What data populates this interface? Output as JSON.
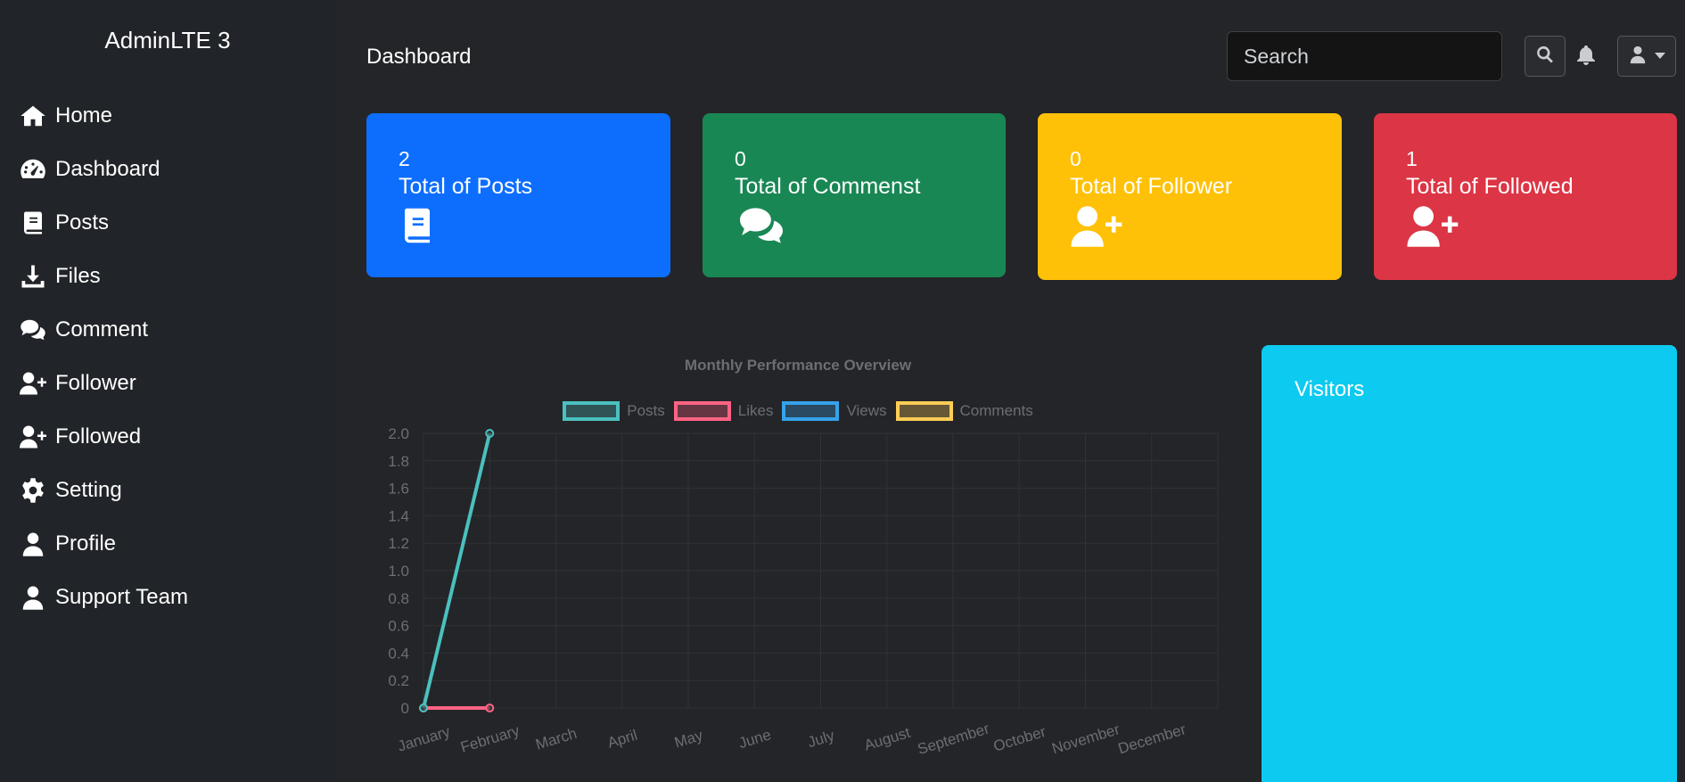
{
  "brand": "AdminLTE 3",
  "sidebar": {
    "items": [
      {
        "label": "Home",
        "icon": "home-icon"
      },
      {
        "label": "Dashboard",
        "icon": "gauge-icon"
      },
      {
        "label": "Posts",
        "icon": "book-icon"
      },
      {
        "label": "Files",
        "icon": "download-icon"
      },
      {
        "label": "Comment",
        "icon": "comments-icon"
      },
      {
        "label": "Follower",
        "icon": "user-plus-icon"
      },
      {
        "label": "Followed",
        "icon": "user-plus-icon"
      },
      {
        "label": "Setting",
        "icon": "gear-icon"
      },
      {
        "label": "Profile",
        "icon": "user-icon"
      },
      {
        "label": "Support Team",
        "icon": "user-icon"
      }
    ]
  },
  "header": {
    "title": "Dashboard",
    "search_placeholder": "Search"
  },
  "cards": [
    {
      "value": "2",
      "label": "Total of Posts",
      "icon": "book-icon",
      "color": "#0d6efd"
    },
    {
      "value": "0",
      "label": "Total of Commenst",
      "icon": "comments-icon",
      "color": "#198754"
    },
    {
      "value": "0",
      "label": "Total of Follower",
      "icon": "user-plus-icon",
      "color": "#ffc107"
    },
    {
      "value": "1",
      "label": "Total of Followed",
      "icon": "user-plus-icon",
      "color": "#dc3545"
    }
  ],
  "chart_data": {
    "type": "line",
    "title": "Monthly Performance Overview",
    "categories": [
      "January",
      "February",
      "March",
      "April",
      "May",
      "June",
      "July",
      "August",
      "September",
      "October",
      "November",
      "December"
    ],
    "series": [
      {
        "name": "Posts",
        "color": "#4bc0c0",
        "values": [
          0,
          2
        ]
      },
      {
        "name": "Likes",
        "color": "#ff6384",
        "values": [
          0,
          0
        ]
      },
      {
        "name": "Views",
        "color": "#36a2eb",
        "values": []
      },
      {
        "name": "Comments",
        "color": "#ffcd56",
        "values": []
      }
    ],
    "yticks": [
      "0",
      "0.2",
      "0.4",
      "0.6",
      "0.8",
      "1.0",
      "1.2",
      "1.4",
      "1.6",
      "1.8",
      "2.0"
    ],
    "ylim": [
      0,
      2
    ],
    "grid": true,
    "legend": "top"
  },
  "visitors": {
    "title": "Visitors"
  }
}
